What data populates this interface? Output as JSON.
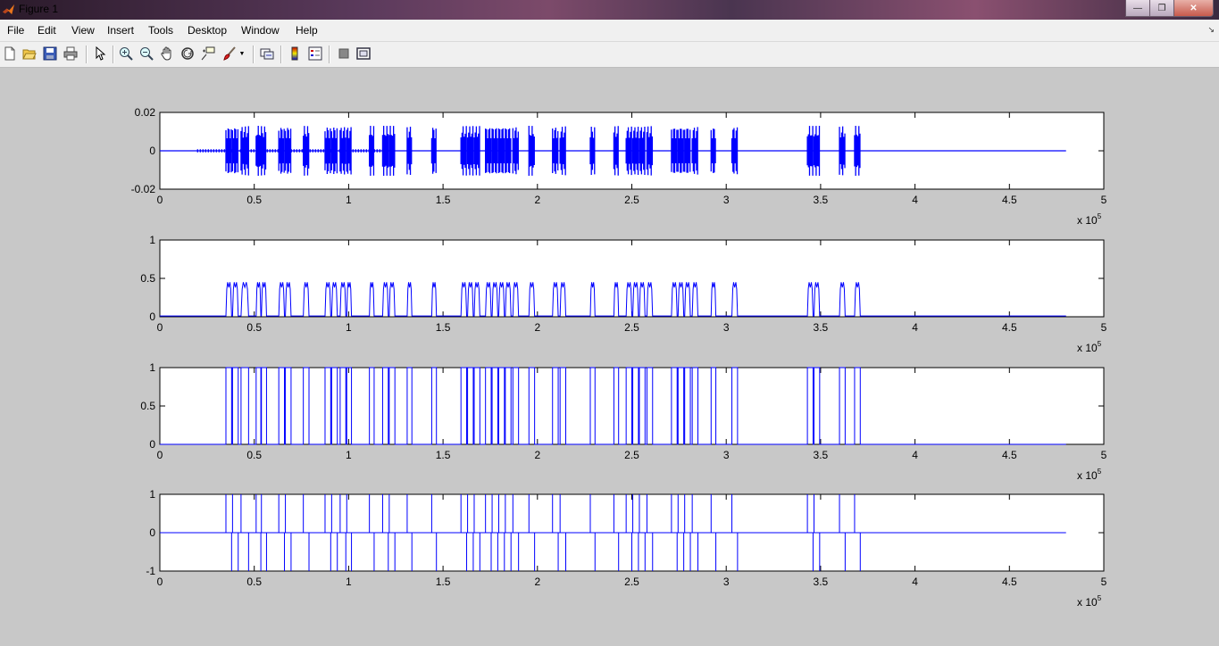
{
  "window": {
    "title": "Figure 1",
    "controls": [
      "minimize",
      "restore",
      "close"
    ]
  },
  "menu": [
    "File",
    "Edit",
    "View",
    "Insert",
    "Tools",
    "Desktop",
    "Window",
    "Help"
  ],
  "toolbar_icons": [
    "new-figure-icon",
    "open-file-icon",
    "save-icon",
    "print-icon",
    "edit-plot-arrow-icon",
    "zoom-in-icon",
    "zoom-out-icon",
    "pan-hand-icon",
    "rotate-3d-icon",
    "data-cursor-icon",
    "brush-icon",
    "link-plot-icon",
    "colorbar-icon",
    "legend-icon",
    "hide-plot-tools-icon",
    "show-plot-tools-icon"
  ],
  "colors": {
    "line": "#0000ff",
    "figure_bg": "#c8c8c8"
  },
  "chart_data": [
    {
      "type": "line",
      "title": "",
      "xlabel": "",
      "ylabel": "",
      "xlim": [
        0,
        500000
      ],
      "ylim": [
        -0.02,
        0.02
      ],
      "xticks": [
        "0",
        "0.5",
        "1",
        "1.5",
        "2",
        "2.5",
        "3",
        "3.5",
        "4",
        "4.5",
        "5"
      ],
      "yticks": [
        "-0.02",
        "0",
        "0.02"
      ],
      "x_exponent": "x 10^5",
      "x_exponent_base": "x 10",
      "x_exponent_power": "5",
      "signal_end": 480000,
      "series": [
        {
          "style": "oscillating bursts",
          "amplitude": 0.013
        }
      ]
    },
    {
      "type": "line",
      "title": "",
      "xlabel": "",
      "ylabel": "",
      "xlim": [
        0,
        500000
      ],
      "ylim": [
        0,
        1
      ],
      "xticks": [
        "0",
        "0.5",
        "1",
        "1.5",
        "2",
        "2.5",
        "3",
        "3.5",
        "4",
        "4.5",
        "5"
      ],
      "yticks": [
        "0",
        "0.5",
        "1"
      ],
      "x_exponent": "x 10^5",
      "x_exponent_base": "x 10",
      "x_exponent_power": "5",
      "signal_end": 480000,
      "series": [
        {
          "style": "envelope pulses",
          "amplitude": 0.45
        }
      ]
    },
    {
      "type": "line",
      "title": "",
      "xlabel": "",
      "ylabel": "",
      "xlim": [
        0,
        500000
      ],
      "ylim": [
        0,
        1
      ],
      "xticks": [
        "0",
        "0.5",
        "1",
        "1.5",
        "2",
        "2.5",
        "3",
        "3.5",
        "4",
        "4.5",
        "5"
      ],
      "yticks": [
        "0",
        "0.5",
        "1"
      ],
      "x_exponent": "x 10^5",
      "x_exponent_base": "x 10",
      "x_exponent_power": "5",
      "signal_end": 480000,
      "series": [
        {
          "style": "binary pulses",
          "amplitude": 1
        }
      ]
    },
    {
      "type": "line",
      "title": "",
      "xlabel": "",
      "ylabel": "",
      "xlim": [
        0,
        500000
      ],
      "ylim": [
        -1,
        1
      ],
      "xticks": [
        "0",
        "0.5",
        "1",
        "1.5",
        "2",
        "2.5",
        "3",
        "3.5",
        "4",
        "4.5",
        "5"
      ],
      "yticks": [
        "-1",
        "0",
        "1"
      ],
      "x_exponent": "x 10^5",
      "x_exponent_base": "x 10",
      "x_exponent_power": "5",
      "signal_end": 480000,
      "series": [
        {
          "style": "edge spikes",
          "amplitude": 1
        }
      ]
    }
  ],
  "bursts": [
    [
      35000,
      38000
    ],
    [
      38500,
      41500
    ],
    [
      43000,
      47000
    ],
    [
      51000,
      53500
    ],
    [
      53800,
      56500
    ],
    [
      63000,
      66000
    ],
    [
      66500,
      69500
    ],
    [
      76000,
      79000
    ],
    [
      87500,
      90500
    ],
    [
      91000,
      94000
    ],
    [
      95500,
      98500
    ],
    [
      99000,
      101500
    ],
    [
      111000,
      113500
    ],
    [
      118000,
      121000
    ],
    [
      121500,
      124500
    ],
    [
      131000,
      133500
    ],
    [
      144000,
      146500
    ],
    [
      159500,
      162500
    ],
    [
      163000,
      166000
    ],
    [
      166500,
      169500
    ],
    [
      172500,
      175500
    ],
    [
      176000,
      179000
    ],
    [
      179500,
      182500
    ],
    [
      183000,
      186000
    ],
    [
      187000,
      190000
    ],
    [
      195500,
      198500
    ],
    [
      208000,
      211000
    ],
    [
      212000,
      215000
    ],
    [
      228000,
      230500
    ],
    [
      240500,
      243000
    ],
    [
      247000,
      250000
    ],
    [
      250500,
      253500
    ],
    [
      254000,
      257000
    ],
    [
      258000,
      261000
    ],
    [
      271000,
      274000
    ],
    [
      274500,
      277500
    ],
    [
      278000,
      281000
    ],
    [
      282000,
      285000
    ],
    [
      292000,
      294500
    ],
    [
      303000,
      306000
    ],
    [
      343000,
      346000
    ],
    [
      346500,
      349500
    ],
    [
      360000,
      363000
    ],
    [
      368000,
      371000
    ]
  ]
}
